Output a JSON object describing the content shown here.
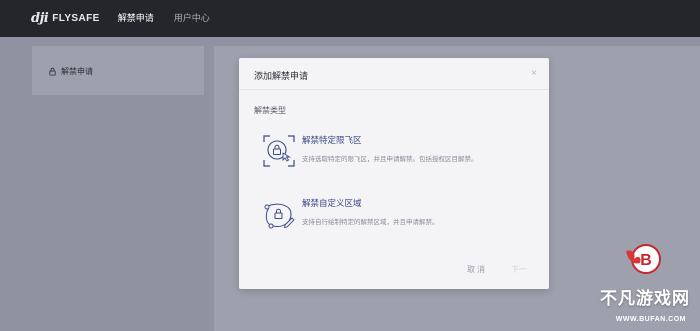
{
  "header": {
    "logo_mark": "dji",
    "logo_text": "FLYSAFE",
    "nav": [
      {
        "label": "解禁申请",
        "active": true
      },
      {
        "label": "用户中心",
        "active": false
      }
    ]
  },
  "sidebar": {
    "items": [
      {
        "label": "解禁申请",
        "icon": "lock-icon"
      }
    ]
  },
  "modal": {
    "title": "添加解禁申请",
    "close_glyph": "×",
    "section_label": "解禁类型",
    "options": [
      {
        "title": "解禁特定限飞区",
        "desc": "支持选取特定的限飞区，并且申请解禁。包括授权区目解禁。",
        "icon": "fence-lock-icon"
      },
      {
        "title": "解禁自定义区域",
        "desc": "支持自行绘制特定的解禁区域，并且申请解禁。",
        "icon": "draw-area-lock-icon"
      }
    ],
    "cancel_label": "取消",
    "ok_label": "下一"
  },
  "watermark": {
    "brand": "不凡游戏网",
    "url": "WWW.BUFAN.COM"
  },
  "colors": {
    "topbar": "#24262b",
    "overlay": "#8f92a0",
    "accent": "#3a4a85"
  }
}
